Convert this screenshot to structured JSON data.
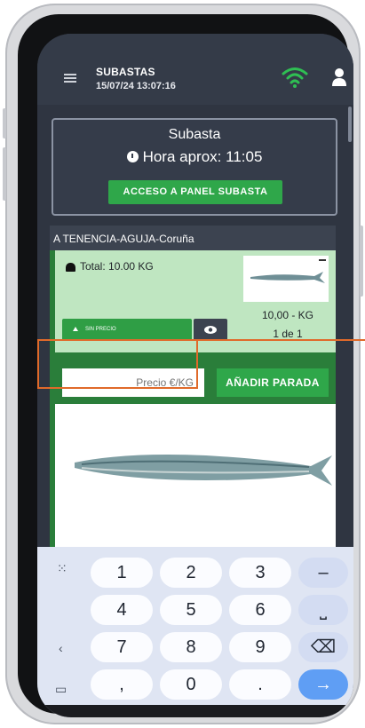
{
  "app": {
    "title": "SUBASTAS",
    "datetime": "15/07/24 13:07:16"
  },
  "auction": {
    "title": "Subasta",
    "time_label": "Hora aprox: 11:05",
    "panel_button": "ACCESO A PANEL SUBASTA"
  },
  "lot": {
    "header": "A TENENCIA-AGUJA-Coruña",
    "total": "Total: 10.00 KG",
    "quantity": "10,00 - KG",
    "position": "1 de 1",
    "price_status": "SIN PRECIO",
    "price_placeholder": "Precio €/KG",
    "add_button": "AÑADIR PARADA"
  },
  "keyboard": {
    "rows": [
      [
        "1",
        "2",
        "3",
        "–"
      ],
      [
        "4",
        "5",
        "6",
        "⎵"
      ],
      [
        "7",
        "8",
        "9",
        "⌫"
      ],
      [
        ",",
        "0",
        ".",
        "→"
      ]
    ]
  },
  "colors": {
    "accent_green": "#2fa74a",
    "header_dark": "#343b48",
    "highlight": "#e06a2a"
  },
  "icons": [
    "menu-icon",
    "wifi-icon",
    "user-icon",
    "clock-icon",
    "weight-icon",
    "eye-icon",
    "grid-icon",
    "back-arrow-icon",
    "keyboard-hide-icon"
  ]
}
